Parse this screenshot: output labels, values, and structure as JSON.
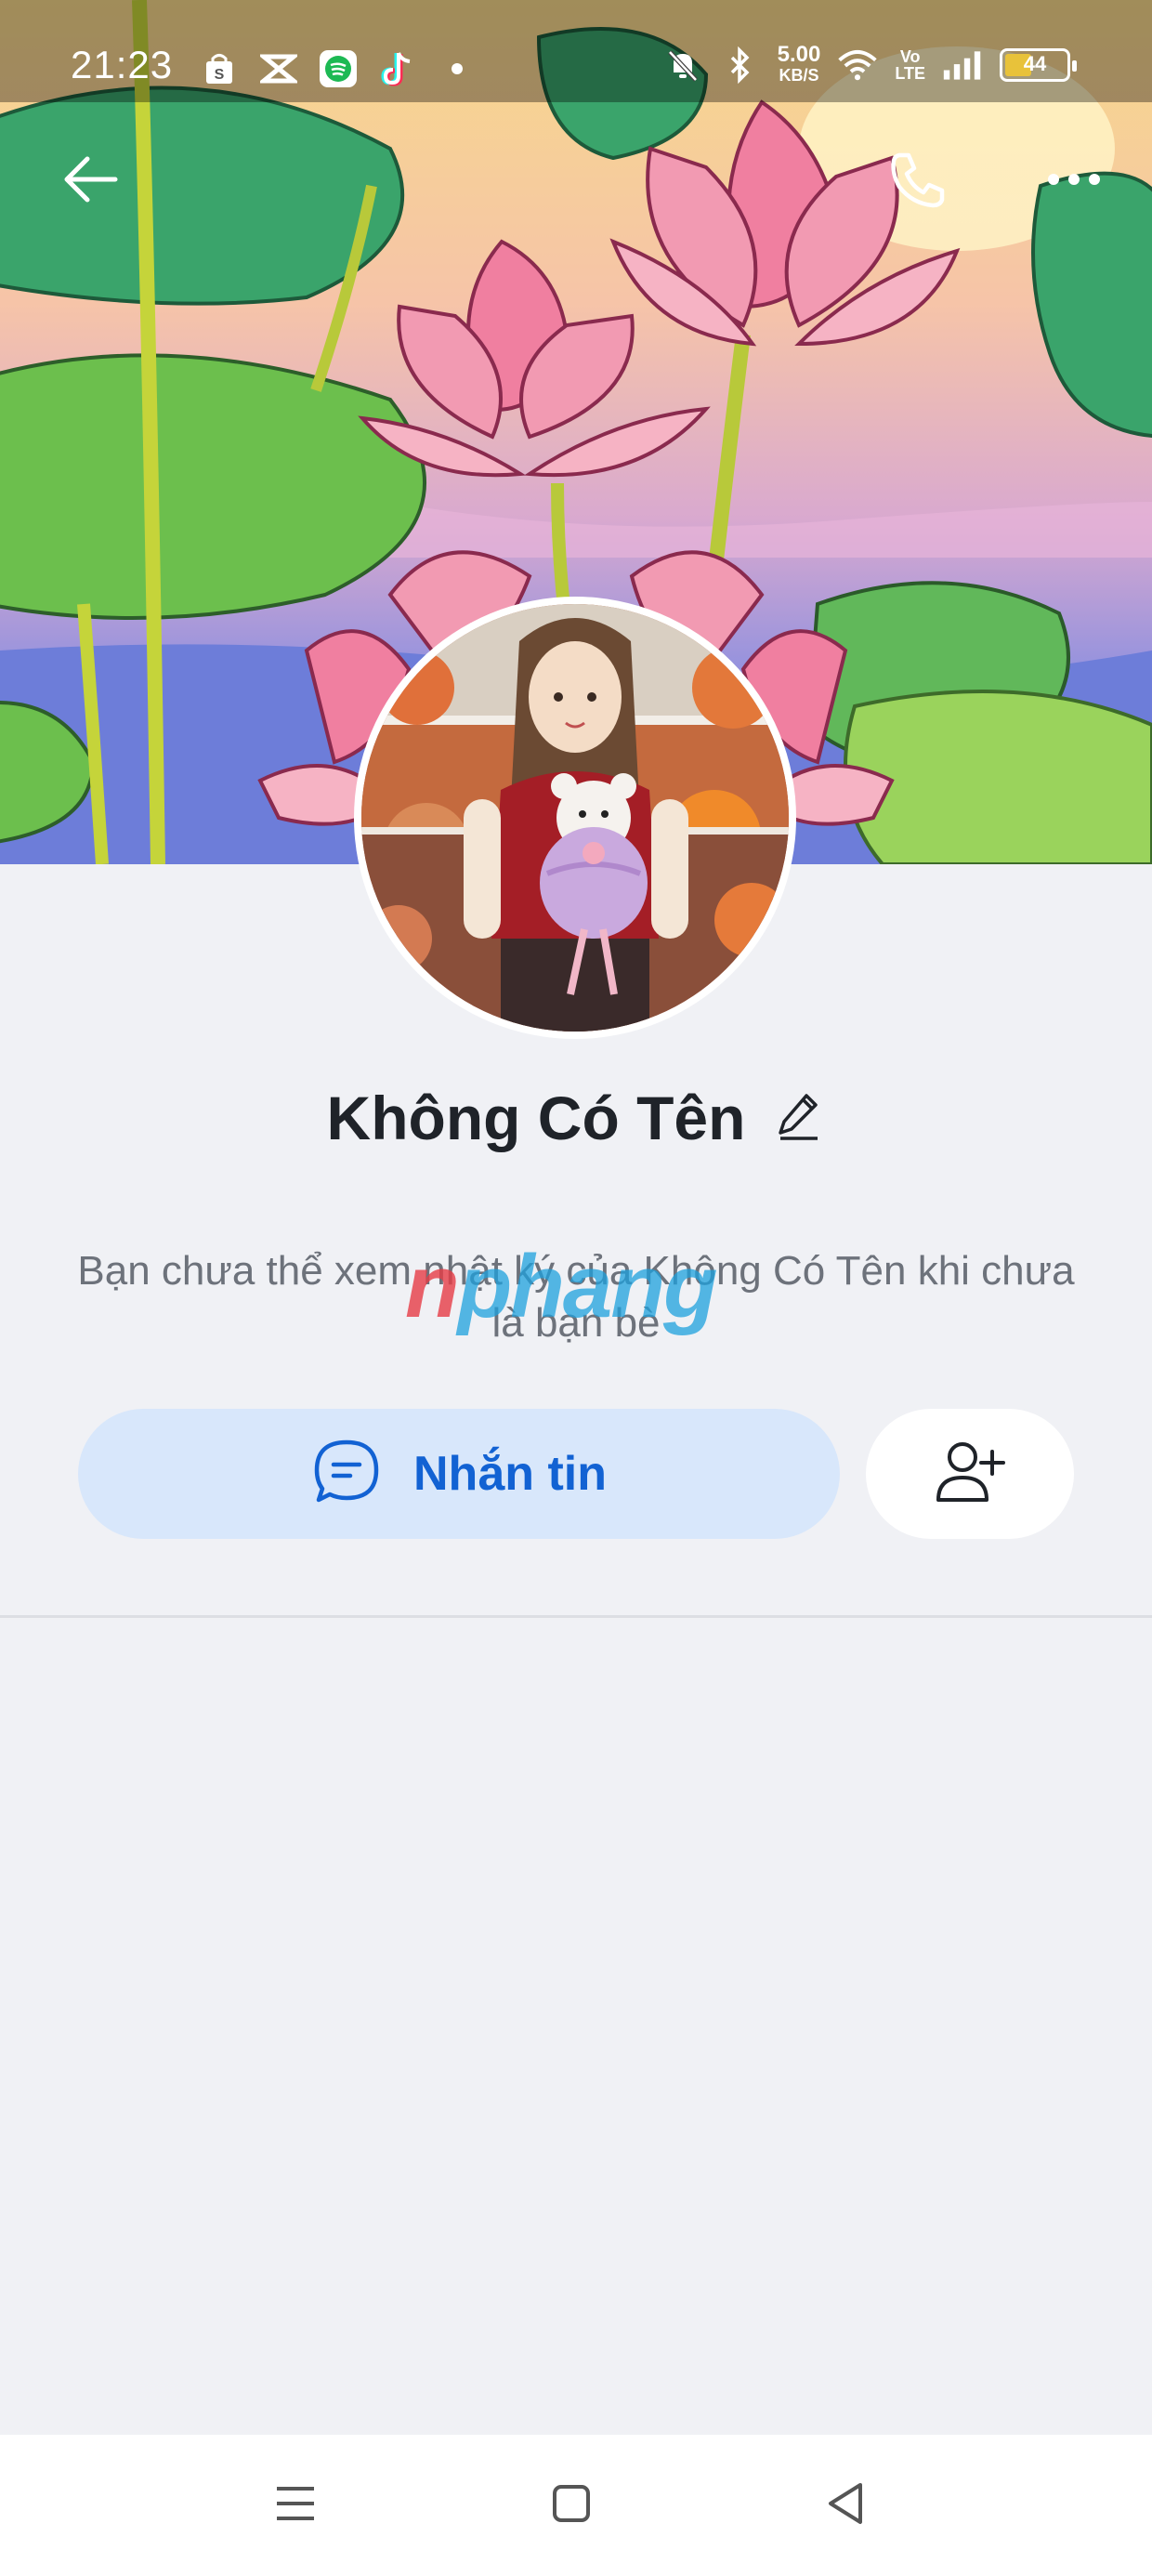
{
  "status_bar": {
    "time": "21:23",
    "net_speed_value": "5.00",
    "net_speed_unit": "KB/S",
    "volte_top": "Vo",
    "volte_bottom": "LTE",
    "battery_level": "44",
    "battery_color": "#e8c23a"
  },
  "profile": {
    "name": "Không Có Tên",
    "diary_notice": "Bạn chưa thể xem nhật ký của Không Có Tên khi chưa là bạn bè"
  },
  "actions": {
    "message_label": "Nhắn tin"
  },
  "watermark": {
    "first": "n",
    "rest": "phang"
  },
  "colors": {
    "accent": "#1262d3",
    "message_button_bg": "#d8e7fb",
    "page_bg": "#f0f1f5"
  },
  "icons": {
    "back": "arrow-left-icon",
    "call": "phone-icon",
    "more": "more-dots-icon",
    "edit": "pencil-icon",
    "chat": "chat-bubble-icon",
    "add_friend": "add-person-icon"
  }
}
